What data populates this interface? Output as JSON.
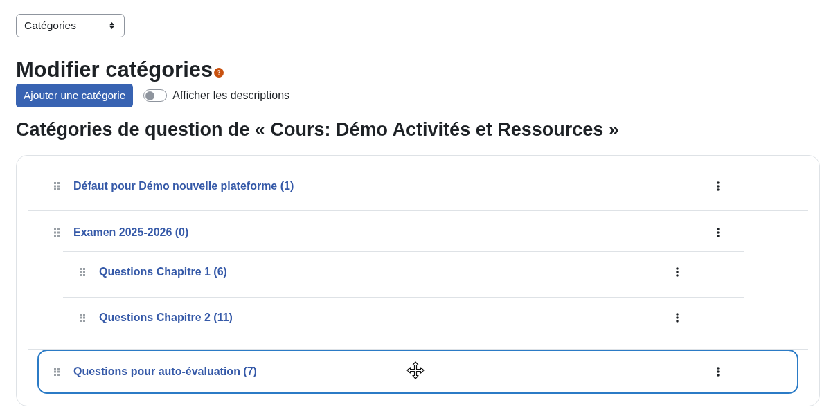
{
  "view_select": {
    "value": "Catégories"
  },
  "page_title": "Modifier catégories",
  "add_button": "Ajouter une catégorie",
  "toggle": {
    "label": "Afficher les descriptions",
    "on": false
  },
  "section_title": "Catégories de question de « Cours: Démo Activités et Ressources »",
  "categories": [
    {
      "label": "Défaut pour Démo nouvelle plateforme (1)",
      "selected": false
    },
    {
      "label": "Examen 2025-2026 (0)",
      "selected": false,
      "children": [
        {
          "label": "Questions Chapitre 1 (6)",
          "selected": false
        },
        {
          "label": "Questions Chapitre 2 (11)",
          "selected": false
        }
      ]
    },
    {
      "label": "Questions pour auto-évaluation (7)",
      "selected": true
    }
  ]
}
